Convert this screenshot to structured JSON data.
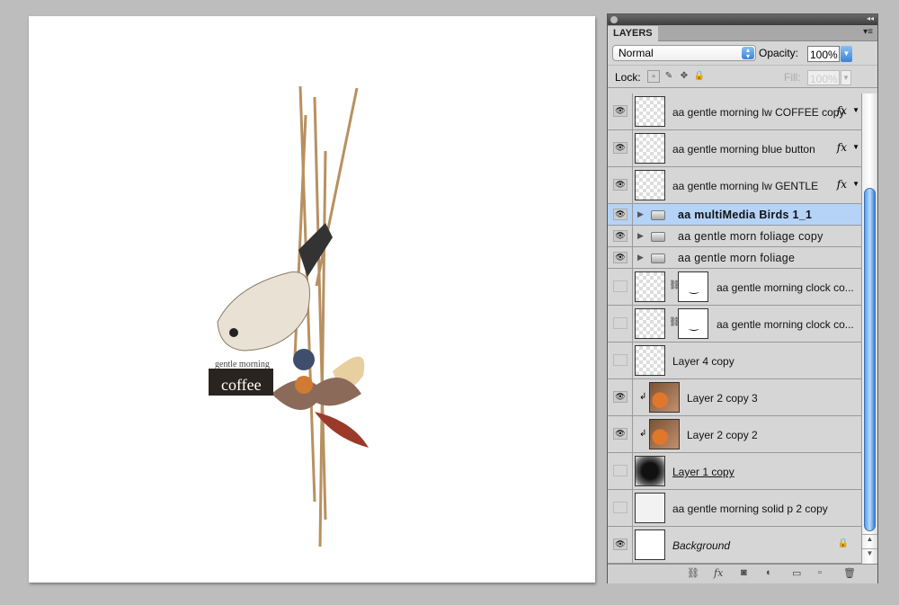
{
  "panel": {
    "tab": "LAYERS",
    "blend_mode": "Normal",
    "opacity_label": "Opacity:",
    "opacity": "100%",
    "lock_label": "Lock:",
    "fill_label": "Fill:",
    "fill": "100%"
  },
  "layers": [
    {
      "name": "aa gentle morning lw COFFEE copy",
      "visible": true,
      "fx": true
    },
    {
      "name": "aa gentle morning blue button",
      "visible": true,
      "fx": true
    },
    {
      "name": "aa gentle morning lw GENTLE",
      "visible": true,
      "fx": true
    },
    {
      "name": "aa multiMedia Birds 1_1",
      "visible": true,
      "group": true,
      "selected": true
    },
    {
      "name": "aa gentle morn foliage copy",
      "visible": true,
      "group": true
    },
    {
      "name": "aa gentle morn foliage",
      "visible": true,
      "group": true
    },
    {
      "name": "aa gentle morning clock co...",
      "visible": false,
      "mask": true
    },
    {
      "name": "aa gentle morning clock co...",
      "visible": false,
      "mask": true
    },
    {
      "name": "Layer 4 copy",
      "visible": false
    },
    {
      "name": "Layer 2 copy 3",
      "visible": true,
      "clipped": true
    },
    {
      "name": "Layer 2 copy 2",
      "visible": true,
      "clipped": true
    },
    {
      "name": "Layer 1 copy",
      "visible": false
    },
    {
      "name": "aa gentle morning solid p 2 copy",
      "visible": false
    },
    {
      "name": "Background",
      "visible": true,
      "locked": true
    }
  ],
  "fx_label": "fx",
  "artwork": {
    "text1": "gentle morning",
    "text2": "coffee"
  },
  "colors": {
    "selection": "#b5d3f7",
    "scroll_accent": "#5a9ae6"
  }
}
